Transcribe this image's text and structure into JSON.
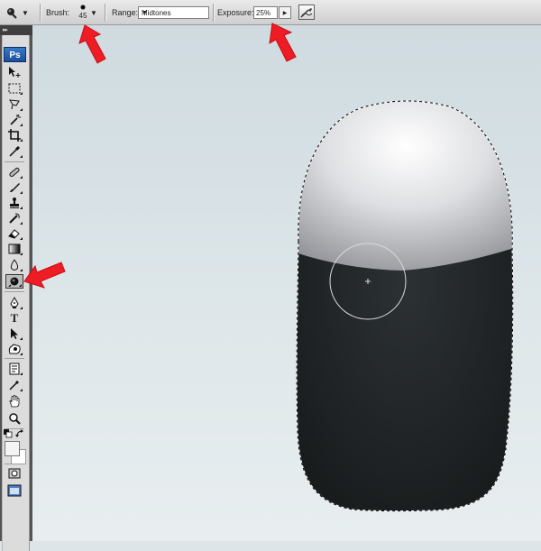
{
  "options_bar": {
    "tool_preset_icon": "burn-tool-icon",
    "dropdown_glyph": "▼",
    "brush_label": "Brush:",
    "brush_size": "45",
    "range_label": "Range:",
    "range_value": "Midtones",
    "exposure_label": "Exposure:",
    "exposure_value": "25%",
    "airbrush_icon": "airbrush-icon"
  },
  "tools_panel": {
    "ps_logo": "Ps",
    "tools": [
      "move-tool-icon",
      "marquee-tool-icon",
      "lasso-tool-icon",
      "magic-wand-icon",
      "crop-tool-icon",
      "eyedropper-slice-icon",
      "healing-brush-icon",
      "brush-tool-icon",
      "clone-stamp-icon",
      "history-brush-icon",
      "eraser-tool-icon",
      "gradient-tool-icon",
      "blur-tool-icon",
      "burn-tool-icon",
      "pen-tool-icon",
      "type-tool-icon",
      "path-selection-icon",
      "custom-shape-icon",
      "notes-tool-icon",
      "eyedropper-tool-icon",
      "hand-tool-icon",
      "zoom-tool-icon"
    ],
    "active_tool": "burn-tool-icon",
    "type_tool_glyph": "T"
  },
  "colors": {
    "highlight_arrow": "#ee1c24",
    "foreground": "#f4f4f4",
    "background": "#ffffff",
    "capsule_top": "#c7c8cc",
    "capsule_bottom": "#1f2326"
  },
  "annotations": [
    "arrow-to-brush",
    "arrow-to-exposure",
    "arrow-to-burn-tool"
  ]
}
